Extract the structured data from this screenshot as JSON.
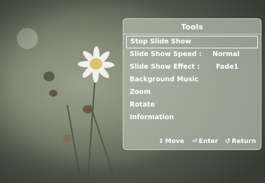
{
  "panel": {
    "title": "Tools",
    "items": [
      {
        "label": "Stop Slide Show",
        "value": ""
      },
      {
        "label": "Slide Show Speed :",
        "value": "Normal"
      },
      {
        "label": "Slide Show Effect  :",
        "value": "Fade1"
      },
      {
        "label": "Background Music",
        "value": ""
      },
      {
        "label": "Zoom",
        "value": ""
      },
      {
        "label": "Rotate",
        "value": ""
      },
      {
        "label": "Information",
        "value": ""
      }
    ],
    "selected_index": 0
  },
  "footer": {
    "move_label": "Move",
    "enter_label": "Enter",
    "return_label": "Return",
    "move_icon": "updown-arrow-icon",
    "enter_icon": "enter-icon",
    "return_icon": "return-icon"
  },
  "colors": {
    "panel_bg": "#afb6a8",
    "text": "#ffffff",
    "flower_petal": "#f2f0ea",
    "flower_center": "#d9c46a"
  }
}
